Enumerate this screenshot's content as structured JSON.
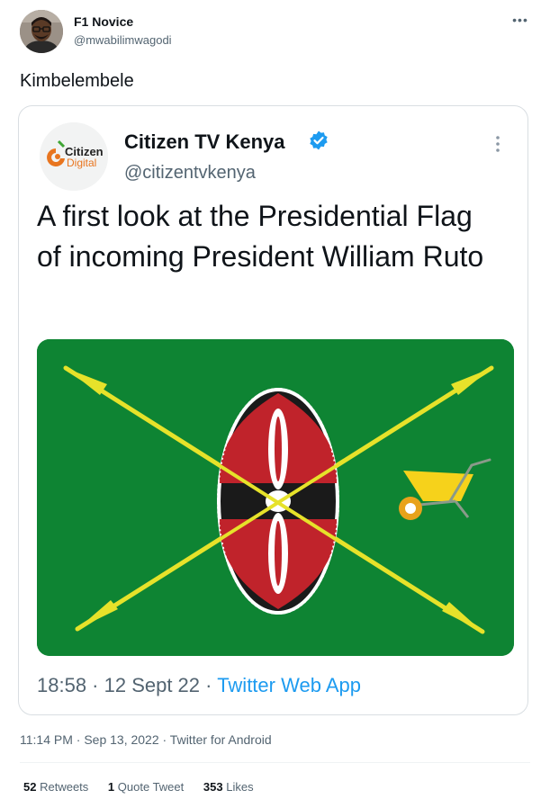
{
  "tweet": {
    "author_name": "F1 Novice",
    "author_handle": "@mwabilimwagodi",
    "text": "Kimbelembele",
    "timestamp": "11:14 PM · Sep 13, 2022 · Twitter for Android",
    "stats": {
      "retweets_count": "52",
      "retweets_label": "Retweets",
      "quotes_count": "1",
      "quotes_label": "Quote Tweet",
      "likes_count": "353",
      "likes_label": "Likes"
    }
  },
  "quoted": {
    "logo_text_1": "Citizen",
    "logo_text_2": "Digital",
    "author_name": "Citizen TV Kenya",
    "author_handle": "@citizentvkenya",
    "text": "A first look at the Presidential Flag of incoming President William Ruto",
    "time": "18:58 · 12 Sept 22 · ",
    "source": "Twitter Web App"
  },
  "colors": {
    "flag_green": "#0e8433",
    "spear_yellow": "#e6e22a",
    "shield_red": "#c0232b",
    "wheelbarrow_yellow": "#f6d21b",
    "link_blue": "#1d9bf0",
    "verified_blue": "#1d9bf0"
  }
}
